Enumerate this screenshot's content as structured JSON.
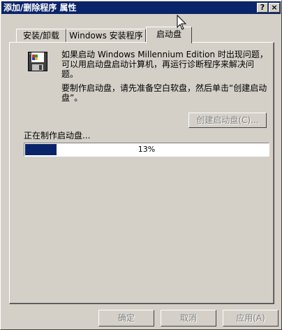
{
  "window": {
    "title": "添加/删除程序 属性",
    "help_button": "?",
    "close_button": "×"
  },
  "tabs": [
    {
      "label": "安装/卸载"
    },
    {
      "label": "Windows 安装程序"
    },
    {
      "label": "启动盘",
      "selected": true
    }
  ],
  "startup_disk": {
    "icon": "floppy-disk-icon",
    "description_1": "如果启动 Windows Millennium Edition 时出现问题，可以用启动盘启动计算机，再运行诊断程序来解决问题。",
    "description_2": "要制作启动盘，请先准备空白软盘，然后单击“创建启动盘”。",
    "create_button": "创建启动盘(C)...",
    "create_button_enabled": false,
    "progress_label": "正在制作启动盘...",
    "progress_percent": 13,
    "progress_text": "13%"
  },
  "footer": {
    "ok_label": "确定",
    "cancel_label": "取消",
    "apply_label": "应用(A)"
  },
  "colors": {
    "title_bar": "#0a246a",
    "face": "#d4d0c8",
    "progress_fill": "#0a246a"
  }
}
